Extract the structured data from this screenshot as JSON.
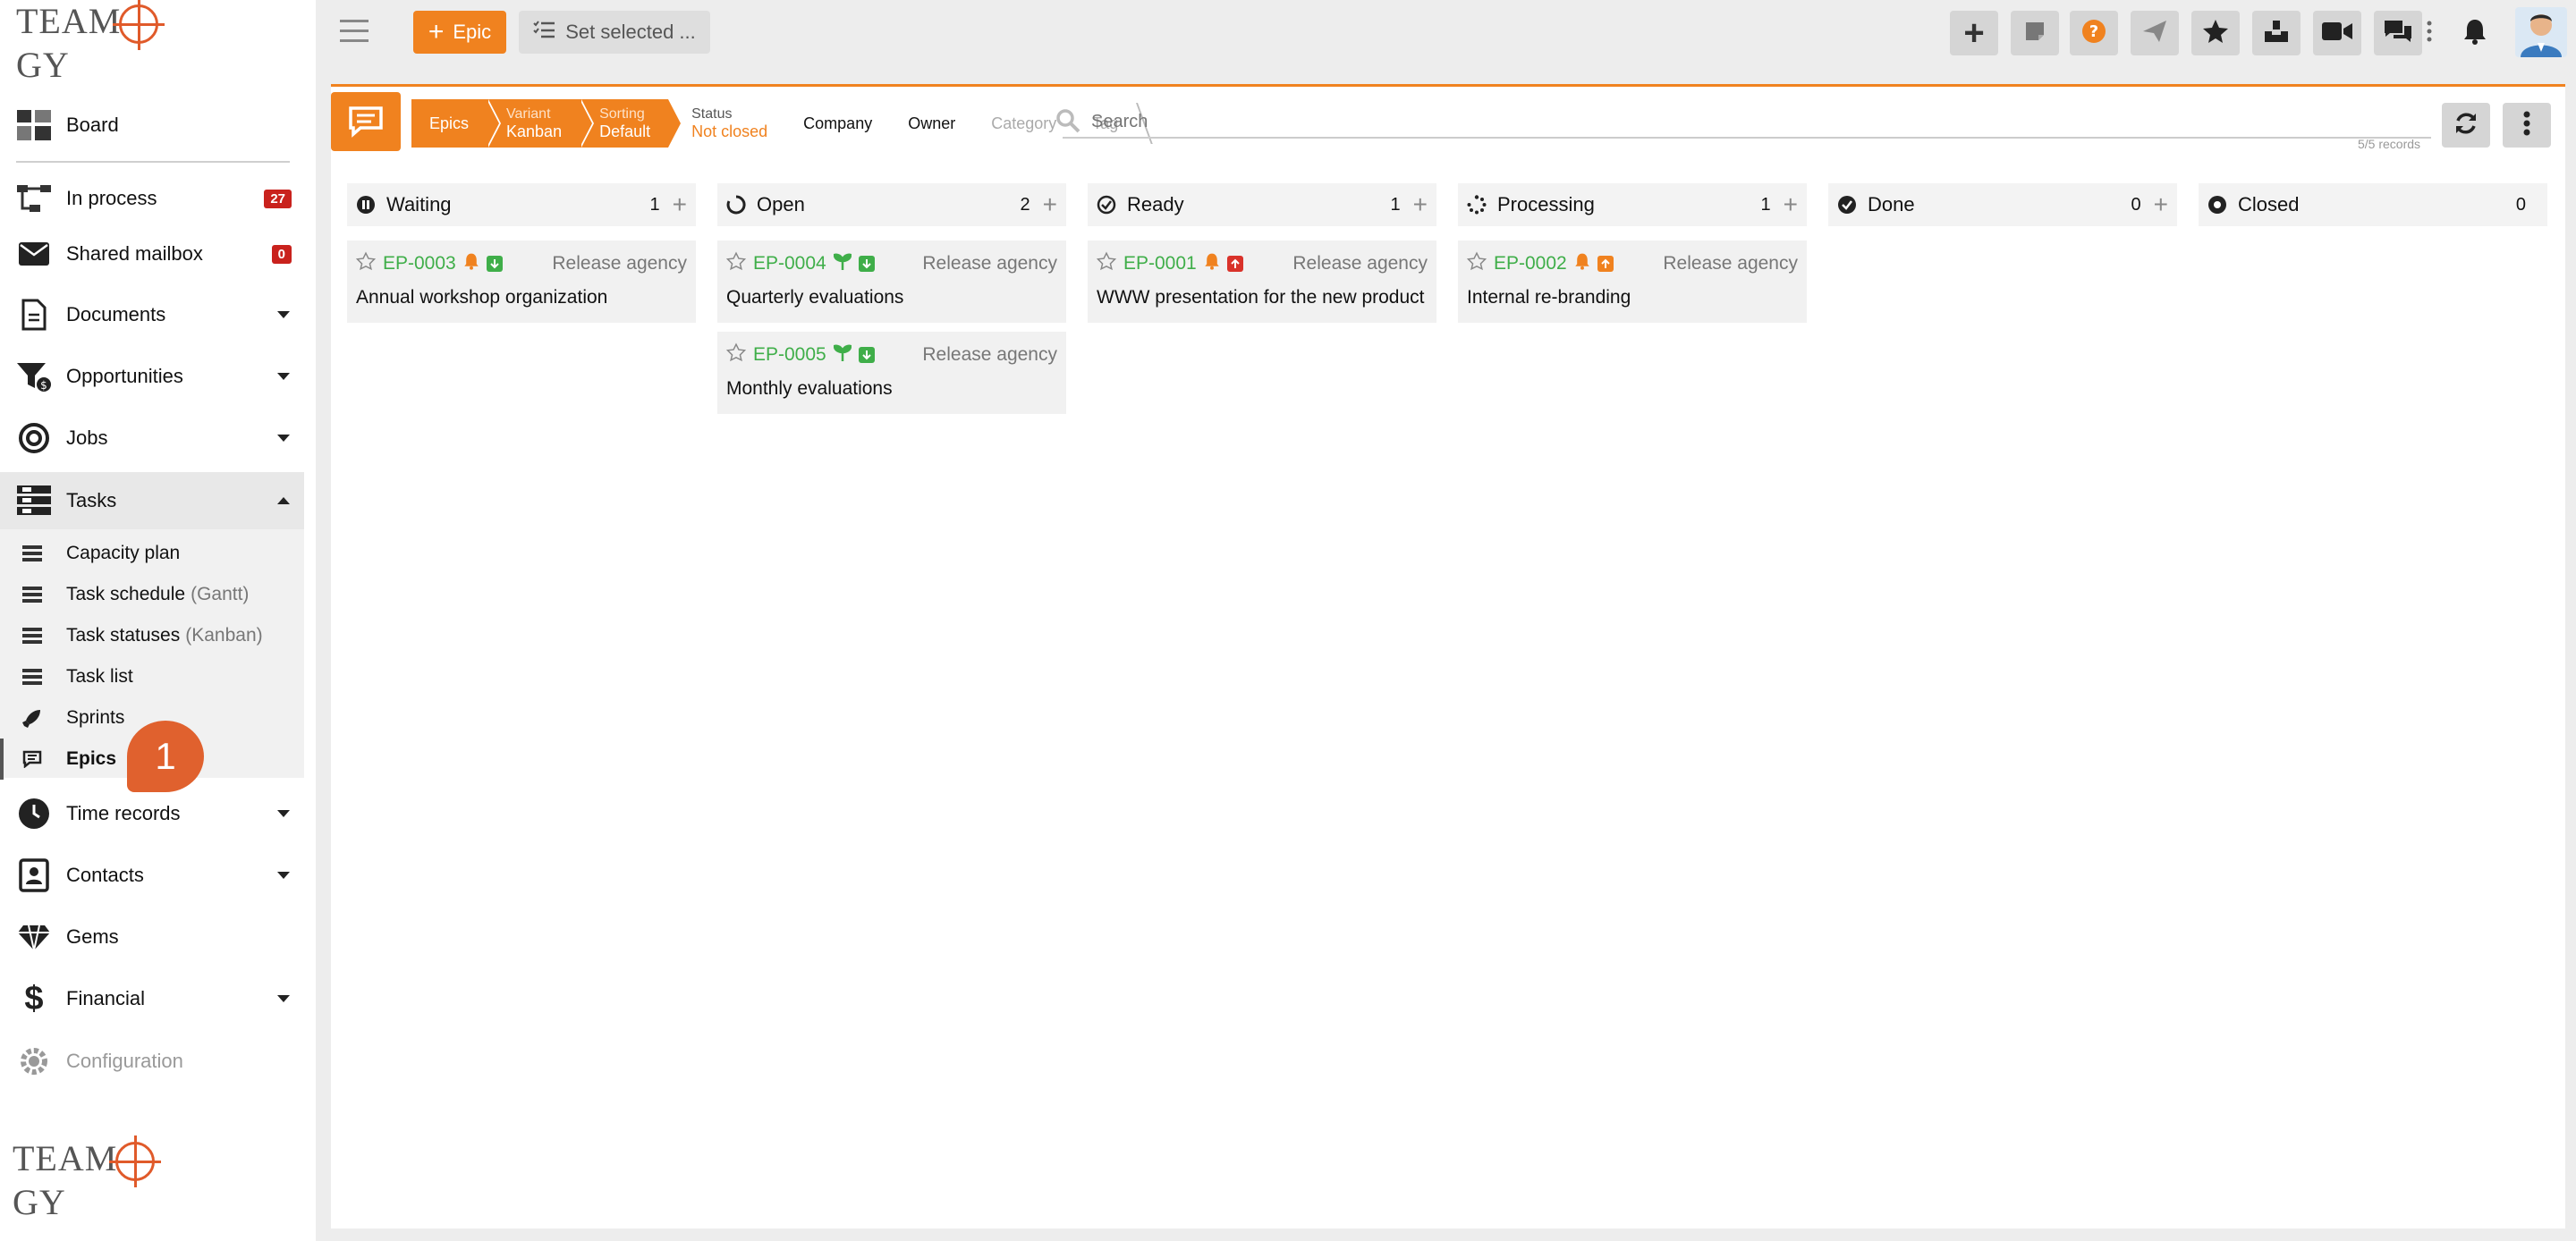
{
  "sidebar": {
    "logo": "TEAMOGY",
    "items": [
      {
        "label": "Board"
      },
      {
        "label": "In process",
        "badge": "27"
      },
      {
        "label": "Shared mailbox",
        "badge": "0"
      },
      {
        "label": "Documents"
      },
      {
        "label": "Opportunities"
      },
      {
        "label": "Jobs"
      },
      {
        "label": "Tasks"
      },
      {
        "label": "Time records"
      },
      {
        "label": "Contacts"
      },
      {
        "label": "Gems"
      },
      {
        "label": "Financial"
      },
      {
        "label": "Configuration"
      }
    ],
    "task_sub": [
      {
        "label": "Capacity plan",
        "muted": ""
      },
      {
        "label": "Task schedule",
        "muted": "(Gantt)"
      },
      {
        "label": "Task statuses",
        "muted": "(Kanban)"
      },
      {
        "label": "Task list",
        "muted": ""
      },
      {
        "label": "Sprints",
        "muted": ""
      },
      {
        "label": "Epics",
        "muted": ""
      }
    ],
    "step_marker": "1"
  },
  "topbar": {
    "new_button": "Epic",
    "set_selected": "Set selected ...",
    "icons": [
      "plus-icon",
      "note-icon",
      "help-icon",
      "send-icon",
      "star-icon",
      "inbox-icon",
      "video-icon",
      "chat-icon",
      "bell-icon"
    ]
  },
  "panel": {
    "crumbs": {
      "epics": "Epics",
      "variant_label": "Variant",
      "variant_value": "Kanban",
      "sorting_label": "Sorting",
      "sorting_value": "Default",
      "status_label": "Status",
      "status_value": "Not closed",
      "company": "Company",
      "owner": "Owner",
      "category": "Category",
      "tag": "Tag"
    },
    "search_placeholder": "Search",
    "records": "5/5 records"
  },
  "columns": [
    {
      "name": "Waiting",
      "count": "1",
      "cards": [
        {
          "code": "EP-0003",
          "agency": "Release agency",
          "title": "Annual workshop organization"
        }
      ]
    },
    {
      "name": "Open",
      "count": "2",
      "cards": [
        {
          "code": "EP-0004",
          "agency": "Release agency",
          "title": "Quarterly evaluations"
        },
        {
          "code": "EP-0005",
          "agency": "Release agency",
          "title": "Monthly evaluations"
        }
      ]
    },
    {
      "name": "Ready",
      "count": "1",
      "cards": [
        {
          "code": "EP-0001",
          "agency": "Release agency",
          "title": "WWW presentation for the new product"
        }
      ]
    },
    {
      "name": "Processing",
      "count": "1",
      "cards": [
        {
          "code": "EP-0002",
          "agency": "Release agency",
          "title": "Internal re-branding"
        }
      ]
    },
    {
      "name": "Done",
      "count": "0",
      "cards": []
    },
    {
      "name": "Closed",
      "count": "0",
      "cards": []
    }
  ],
  "colors": {
    "accent": "#f0821f",
    "badge": "#c9221d",
    "code_green": "#3fae49",
    "step_marker": "#e0612e"
  }
}
